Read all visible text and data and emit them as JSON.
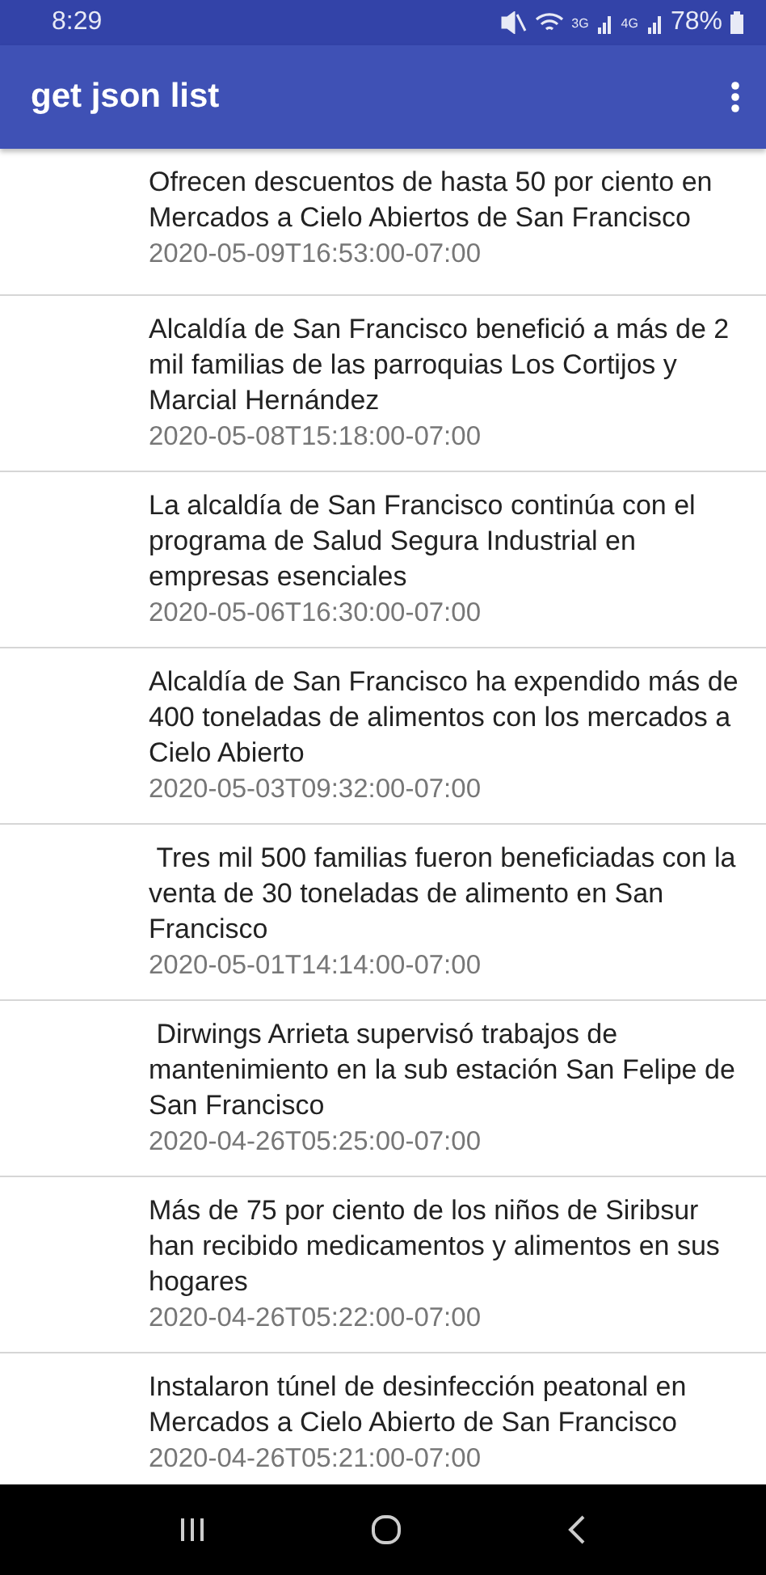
{
  "status_bar": {
    "time": "8:29",
    "network_labels": [
      "3G",
      "4G"
    ],
    "battery": "78%"
  },
  "app_bar": {
    "title": "get json list"
  },
  "items": [
    {
      "title": "Ofrecen descuentos de hasta 50 por ciento en Mercados a Cielo Abiertos de San Francisco",
      "date": "2020-05-09T16:53:00-07:00"
    },
    {
      "title": "Alcaldía de San Francisco benefició a más de 2 mil familias de las parroquias Los Cortijos y Marcial Hernández",
      "date": "2020-05-08T15:18:00-07:00"
    },
    {
      "title": "La alcaldía de San Francisco continúa con el programa de Salud Segura Industrial en empresas esenciales",
      "date": "2020-05-06T16:30:00-07:00"
    },
    {
      "title": "Alcaldía de San Francisco ha expendido más de 400 toneladas de alimentos con los mercados a Cielo Abierto",
      "date": "2020-05-03T09:32:00-07:00"
    },
    {
      "title": " Tres mil 500 familias fueron beneficiadas con la venta de 30 toneladas de alimento en San Francisco",
      "date": "2020-05-01T14:14:00-07:00"
    },
    {
      "title": " Dirwings Arrieta supervisó trabajos de mantenimiento en la sub estación San Felipe de San Francisco",
      "date": "2020-04-26T05:25:00-07:00"
    },
    {
      "title": "Más de 75 por ciento de los niños de Siribsur han recibido medicamentos y alimentos en sus hogares",
      "date": "2020-04-26T05:22:00-07:00"
    },
    {
      "title": "Instalaron túnel de desinfección peatonal en Mercados a Cielo Abierto de San Francisco",
      "date": "2020-04-26T05:21:00-07:00"
    }
  ]
}
